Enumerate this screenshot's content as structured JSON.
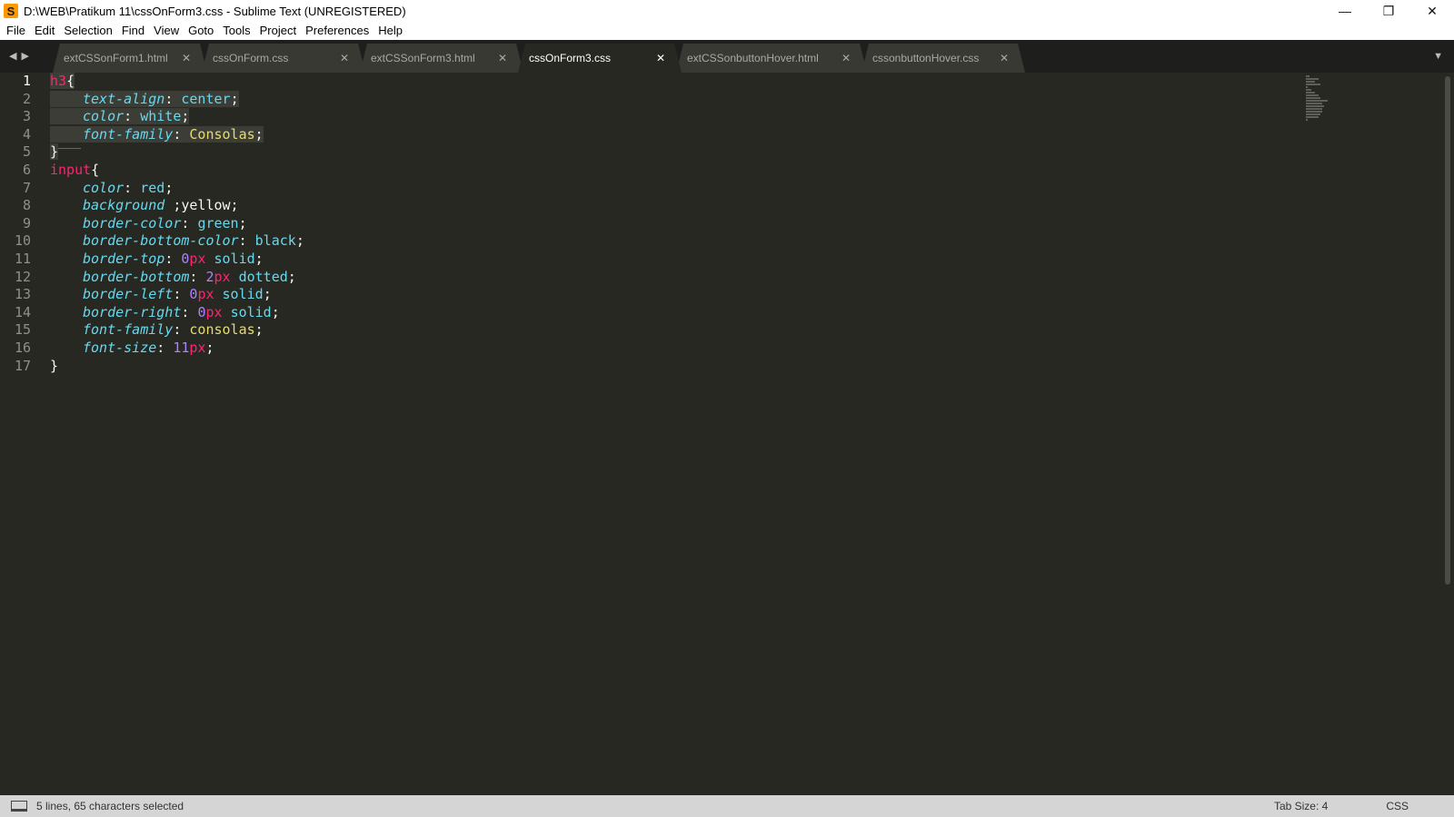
{
  "window": {
    "app_icon_glyph": "S",
    "title": "D:\\WEB\\Pratikum 11\\cssOnForm3.css - Sublime Text (UNREGISTERED)",
    "minimize_glyph": "—",
    "maximize_glyph": "❐",
    "close_glyph": "✕"
  },
  "menu": [
    "File",
    "Edit",
    "Selection",
    "Find",
    "View",
    "Goto",
    "Tools",
    "Project",
    "Preferences",
    "Help"
  ],
  "tabs": [
    {
      "label": "extCSSonForm1.html",
      "active": false
    },
    {
      "label": "cssOnForm.css",
      "active": false
    },
    {
      "label": "extCSSonForm3.html",
      "active": false
    },
    {
      "label": "cssOnForm3.css",
      "active": true
    },
    {
      "label": "extCSSonbuttonHover.html",
      "active": false
    },
    {
      "label": "cssonbuttonHover.css",
      "active": false
    }
  ],
  "icons": {
    "nav_left": "◀",
    "nav_right": "▶",
    "tab_close": "✕",
    "tab_dropdown": "▼"
  },
  "editor": {
    "line_numbers": [
      "1",
      "2",
      "3",
      "4",
      "5",
      "6",
      "7",
      "8",
      "9",
      "10",
      "11",
      "12",
      "13",
      "14",
      "15",
      "16",
      "17"
    ],
    "lines": [
      [
        {
          "t": "h3",
          "c": "sel"
        },
        {
          "t": "{",
          "c": "brace"
        }
      ],
      [
        {
          "t": "text-align",
          "c": "prop"
        },
        {
          "t": ": ",
          "c": "plain"
        },
        {
          "t": "center",
          "c": "val"
        },
        {
          "t": ";",
          "c": "plain"
        }
      ],
      [
        {
          "t": "color",
          "c": "prop"
        },
        {
          "t": ": ",
          "c": "plain"
        },
        {
          "t": "white",
          "c": "val"
        },
        {
          "t": ";",
          "c": "plain"
        }
      ],
      [
        {
          "t": "font-family",
          "c": "prop"
        },
        {
          "t": ": ",
          "c": "plain"
        },
        {
          "t": "Consolas",
          "c": "str"
        },
        {
          "t": ";",
          "c": "plain"
        }
      ],
      [
        {
          "t": "}",
          "c": "brace"
        }
      ],
      [
        {
          "t": "input",
          "c": "sel"
        },
        {
          "t": "{",
          "c": "brace"
        }
      ],
      [
        {
          "t": "color",
          "c": "prop"
        },
        {
          "t": ": ",
          "c": "plain"
        },
        {
          "t": "red",
          "c": "val"
        },
        {
          "t": ";",
          "c": "plain"
        }
      ],
      [
        {
          "t": "background",
          "c": "prop"
        },
        {
          "t": " ;yellow;",
          "c": "plain"
        }
      ],
      [
        {
          "t": "border-color",
          "c": "prop"
        },
        {
          "t": ": ",
          "c": "plain"
        },
        {
          "t": "green",
          "c": "val"
        },
        {
          "t": ";",
          "c": "plain"
        }
      ],
      [
        {
          "t": "border-bottom-color",
          "c": "prop"
        },
        {
          "t": ": ",
          "c": "plain"
        },
        {
          "t": "black",
          "c": "val"
        },
        {
          "t": ";",
          "c": "plain"
        }
      ],
      [
        {
          "t": "border-top",
          "c": "prop"
        },
        {
          "t": ": ",
          "c": "plain"
        },
        {
          "t": "0",
          "c": "num"
        },
        {
          "t": "px",
          "c": "unit"
        },
        {
          "t": " ",
          "c": "plain"
        },
        {
          "t": "solid",
          "c": "val"
        },
        {
          "t": ";",
          "c": "plain"
        }
      ],
      [
        {
          "t": "border-bottom",
          "c": "prop"
        },
        {
          "t": ": ",
          "c": "plain"
        },
        {
          "t": "2",
          "c": "num"
        },
        {
          "t": "px",
          "c": "unit"
        },
        {
          "t": " ",
          "c": "plain"
        },
        {
          "t": "dotted",
          "c": "val"
        },
        {
          "t": ";",
          "c": "plain"
        }
      ],
      [
        {
          "t": "border-left",
          "c": "prop"
        },
        {
          "t": ": ",
          "c": "plain"
        },
        {
          "t": "0",
          "c": "num"
        },
        {
          "t": "px",
          "c": "unit"
        },
        {
          "t": " ",
          "c": "plain"
        },
        {
          "t": "solid",
          "c": "val"
        },
        {
          "t": ";",
          "c": "plain"
        }
      ],
      [
        {
          "t": "border-right",
          "c": "prop"
        },
        {
          "t": ": ",
          "c": "plain"
        },
        {
          "t": "0",
          "c": "num"
        },
        {
          "t": "px",
          "c": "unit"
        },
        {
          "t": " ",
          "c": "plain"
        },
        {
          "t": "solid",
          "c": "val"
        },
        {
          "t": ";",
          "c": "plain"
        }
      ],
      [
        {
          "t": "font-family",
          "c": "prop"
        },
        {
          "t": ": ",
          "c": "plain"
        },
        {
          "t": "consolas",
          "c": "str"
        },
        {
          "t": ";",
          "c": "plain"
        }
      ],
      [
        {
          "t": "font-size",
          "c": "prop"
        },
        {
          "t": ": ",
          "c": "plain"
        },
        {
          "t": "11",
          "c": "num"
        },
        {
          "t": "px",
          "c": "unit"
        },
        {
          "t": ";",
          "c": "plain"
        }
      ],
      [
        {
          "t": "}",
          "c": "brace"
        }
      ]
    ],
    "indented_lines": [
      2,
      3,
      4,
      7,
      8,
      9,
      10,
      11,
      12,
      13,
      14,
      15,
      16
    ],
    "selected_lines": [
      1,
      2,
      3,
      4,
      5
    ]
  },
  "status": {
    "selection_text": "5 lines, 65 characters selected",
    "tab_size": "Tab Size: 4",
    "syntax": "CSS"
  },
  "colors": {
    "editor_bg": "#272822",
    "selector": "#f92672",
    "property": "#66d9ef",
    "string": "#e6db74",
    "number": "#ae81ff",
    "status_bg": "#d5d5d5"
  }
}
